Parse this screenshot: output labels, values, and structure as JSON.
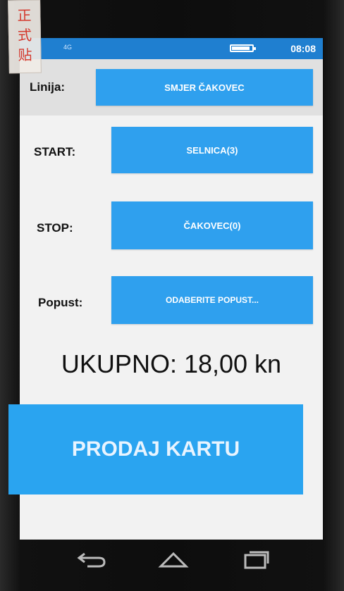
{
  "status_bar": {
    "network": "4G",
    "time": "08:08"
  },
  "sticker": {
    "text_line1": "正",
    "text_line2": "式",
    "text_line3": "贴"
  },
  "form": {
    "line_label": "Linija:",
    "line_value": "SMJER ČAKOVEC",
    "start_label": "START:",
    "start_value": "SELNICA(3)",
    "stop_label": "STOP:",
    "stop_value": "ČAKOVEC(0)",
    "discount_label": "Popust:",
    "discount_value": "ODABERITE POPUST..."
  },
  "total": "UKUPNO: 18,00 kn",
  "sell_button": "PRODAJ KARTU",
  "navigation": {
    "icons": [
      "back-icon",
      "home-icon",
      "recents-icon"
    ]
  },
  "colors": {
    "status_bar": "#1f7fd0",
    "accent_button": "#2fa0ee",
    "sell_button": "#2aa4f0",
    "sticker_text": "#d4372b"
  }
}
